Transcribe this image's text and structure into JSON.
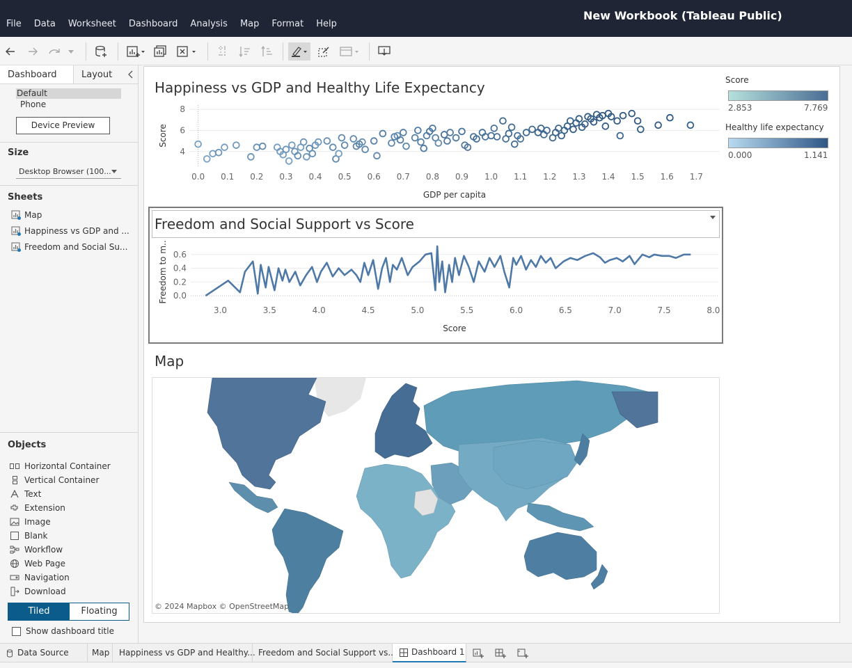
{
  "app": {
    "title": "New Workbook (Tableau Public)",
    "menu": [
      "File",
      "Data",
      "Worksheet",
      "Dashboard",
      "Analysis",
      "Map",
      "Format",
      "Help"
    ]
  },
  "left_panel": {
    "tab_dashboard": "Dashboard",
    "tab_layout": "Layout",
    "device_default": "Default",
    "device_phone": "Phone",
    "device_preview": "Device Preview",
    "size_heading": "Size",
    "size_value": "Desktop Browser (100...",
    "sheets_heading": "Sheets",
    "sheets": [
      "Map",
      "Happiness vs GDP and ...",
      "Freedom and Social Su..."
    ],
    "objects_heading": "Objects",
    "objects": [
      "Horizontal Container",
      "Vertical Container",
      "Text",
      "Extension",
      "Image",
      "Blank",
      "Workflow",
      "Web Page",
      "Navigation",
      "Download"
    ],
    "tiled": "Tiled",
    "floating": "Floating",
    "show_title": "Show dashboard title"
  },
  "dashboard": {
    "chart1_title": "Happiness vs GDP and Healthy Life Expectancy",
    "chart2_title": "Freedom and Social Support vs Score",
    "map_title": "Map",
    "map_attribution": "© 2024 Mapbox  © OpenStreetMap"
  },
  "legends": {
    "score": {
      "title": "Score",
      "min": "2.853",
      "max": "7.769",
      "color_low": "#b6e0dc",
      "color_high": "#4a6e95"
    },
    "life": {
      "title": "Healthy life expectancy",
      "min": "0.000",
      "max": "1.141",
      "color_low": "#b8daf0",
      "color_high": "#2e5786"
    }
  },
  "bottom_tabs": {
    "data_source": "Data Source",
    "tabs": [
      "Map",
      "Happiness vs GDP and Healthy...",
      "Freedom and Social Support vs...",
      "Dashboard 1"
    ]
  },
  "colors": {
    "titlebar": "#1f2535",
    "accent": "#0b5c8a",
    "mark_dark": "#2f5883",
    "mark_light": "#8fb8d8",
    "line": "#4e79a7"
  },
  "chart_data": [
    {
      "type": "scatter",
      "title": "Happiness vs GDP and Healthy Life Expectancy",
      "xlabel": "GDP per capita",
      "ylabel": "Score",
      "xlim": [
        -0.03,
        1.78
      ],
      "ylim": [
        2.6,
        8.4
      ],
      "xticks": [
        "0.0",
        "0.1",
        "0.2",
        "0.3",
        "0.4",
        "0.5",
        "0.6",
        "0.7",
        "0.8",
        "0.9",
        "1.0",
        "1.1",
        "1.2",
        "1.3",
        "1.4",
        "1.5",
        "1.6",
        "1.7"
      ],
      "yticks": [
        "4",
        "6",
        "8"
      ],
      "points": [
        [
          0.0,
          4.7,
          0.3
        ],
        [
          0.03,
          3.3,
          0.25
        ],
        [
          0.05,
          3.8,
          0.3
        ],
        [
          0.07,
          3.9,
          0.4
        ],
        [
          0.09,
          4.4,
          0.3
        ],
        [
          0.13,
          4.6,
          0.35
        ],
        [
          0.18,
          3.5,
          0.4
        ],
        [
          0.2,
          4.4,
          0.45
        ],
        [
          0.22,
          4.5,
          0.5
        ],
        [
          0.27,
          4.4,
          0.3
        ],
        [
          0.28,
          4.0,
          0.35
        ],
        [
          0.29,
          3.7,
          0.3
        ],
        [
          0.3,
          4.2,
          0.4
        ],
        [
          0.31,
          3.1,
          0.25
        ],
        [
          0.32,
          4.6,
          0.35
        ],
        [
          0.33,
          4.0,
          0.4
        ],
        [
          0.34,
          3.6,
          0.45
        ],
        [
          0.35,
          4.4,
          0.3
        ],
        [
          0.36,
          4.9,
          0.4
        ],
        [
          0.37,
          3.5,
          0.35
        ],
        [
          0.38,
          4.3,
          0.5
        ],
        [
          0.39,
          3.8,
          0.45
        ],
        [
          0.4,
          4.6,
          0.4
        ],
        [
          0.41,
          4.9,
          0.35
        ],
        [
          0.44,
          5.0,
          0.45
        ],
        [
          0.46,
          4.4,
          0.5
        ],
        [
          0.47,
          3.3,
          0.55
        ],
        [
          0.48,
          3.8,
          0.3
        ],
        [
          0.49,
          5.3,
          0.5
        ],
        [
          0.5,
          4.6,
          0.55
        ],
        [
          0.53,
          5.2,
          0.5
        ],
        [
          0.54,
          4.5,
          0.55
        ],
        [
          0.55,
          4.7,
          0.6
        ],
        [
          0.56,
          4.9,
          0.45
        ],
        [
          0.57,
          4.2,
          0.55
        ],
        [
          0.6,
          5.0,
          0.6
        ],
        [
          0.61,
          3.6,
          0.5
        ],
        [
          0.63,
          5.7,
          0.65
        ],
        [
          0.66,
          4.8,
          0.55
        ],
        [
          0.67,
          5.4,
          0.6
        ],
        [
          0.68,
          5.5,
          0.45
        ],
        [
          0.69,
          5.1,
          0.65
        ],
        [
          0.7,
          5.8,
          0.6
        ],
        [
          0.71,
          4.5,
          0.55
        ],
        [
          0.74,
          5.3,
          0.6
        ],
        [
          0.75,
          6.0,
          0.65
        ],
        [
          0.76,
          4.9,
          0.6
        ],
        [
          0.77,
          4.3,
          0.7
        ],
        [
          0.78,
          5.5,
          0.65
        ],
        [
          0.79,
          5.9,
          0.7
        ],
        [
          0.8,
          6.2,
          0.7
        ],
        [
          0.81,
          5.3,
          0.6
        ],
        [
          0.82,
          4.8,
          0.5
        ],
        [
          0.84,
          5.6,
          0.75
        ],
        [
          0.85,
          5.0,
          0.7
        ],
        [
          0.86,
          5.8,
          0.65
        ],
        [
          0.88,
          5.3,
          0.7
        ],
        [
          0.9,
          5.9,
          0.75
        ],
        [
          0.91,
          4.6,
          0.7
        ],
        [
          0.92,
          4.4,
          0.7
        ],
        [
          0.94,
          5.4,
          0.75
        ],
        [
          0.95,
          5.2,
          0.8
        ],
        [
          0.97,
          5.8,
          0.75
        ],
        [
          0.98,
          5.4,
          0.75
        ],
        [
          1.0,
          5.5,
          0.8
        ],
        [
          1.01,
          6.2,
          0.75
        ],
        [
          1.02,
          5.4,
          0.8
        ],
        [
          1.04,
          6.9,
          0.85
        ],
        [
          1.05,
          5.2,
          0.8
        ],
        [
          1.06,
          5.7,
          0.85
        ],
        [
          1.07,
          6.3,
          0.8
        ],
        [
          1.08,
          4.7,
          0.85
        ],
        [
          1.09,
          5.5,
          0.8
        ],
        [
          1.1,
          5.2,
          0.75
        ],
        [
          1.12,
          5.8,
          0.85
        ],
        [
          1.14,
          6.1,
          0.85
        ],
        [
          1.16,
          5.8,
          0.9
        ],
        [
          1.17,
          6.2,
          0.9
        ],
        [
          1.18,
          5.6,
          0.85
        ],
        [
          1.19,
          6.0,
          0.85
        ],
        [
          1.21,
          5.3,
          0.9
        ],
        [
          1.22,
          5.8,
          0.9
        ],
        [
          1.23,
          6.2,
          0.9
        ],
        [
          1.24,
          5.5,
          0.95
        ],
        [
          1.25,
          6.0,
          0.9
        ],
        [
          1.26,
          6.4,
          0.95
        ],
        [
          1.27,
          6.9,
          0.95
        ],
        [
          1.28,
          6.1,
          1.0
        ],
        [
          1.29,
          6.7,
          0.95
        ],
        [
          1.3,
          7.1,
          1.0
        ],
        [
          1.31,
          6.3,
          0.95
        ],
        [
          1.32,
          6.6,
          1.0
        ],
        [
          1.33,
          7.3,
          1.0
        ],
        [
          1.34,
          7.1,
          1.0
        ],
        [
          1.35,
          6.8,
          1.05
        ],
        [
          1.36,
          7.5,
          1.0
        ],
        [
          1.37,
          7.2,
          1.05
        ],
        [
          1.38,
          7.4,
          1.05
        ],
        [
          1.39,
          6.4,
          1.0
        ],
        [
          1.4,
          7.6,
          1.05
        ],
        [
          1.41,
          7.3,
          1.05
        ],
        [
          1.43,
          6.9,
          1.05
        ],
        [
          1.44,
          5.5,
          0.9
        ],
        [
          1.45,
          7.4,
          1.05
        ],
        [
          1.48,
          7.6,
          1.05
        ],
        [
          1.5,
          6.9,
          1.05
        ],
        [
          1.51,
          6.1,
          1.0
        ],
        [
          1.57,
          6.5,
          1.0
        ],
        [
          1.61,
          7.2,
          1.05
        ],
        [
          1.68,
          6.5,
          0.95
        ]
      ]
    },
    {
      "type": "line",
      "title": "Freedom and Social Support vs Score",
      "xlabel": "Score",
      "ylabel": "Freedom to m...",
      "xlim": [
        2.7,
        8.05
      ],
      "ylim": [
        -0.05,
        0.78
      ],
      "xticks": [
        "3.0",
        "3.5",
        "4.0",
        "4.5",
        "5.0",
        "5.5",
        "6.0",
        "6.5",
        "7.0",
        "7.5",
        "8.0"
      ],
      "yticks": [
        "0.0",
        "0.2",
        "0.4",
        "0.6"
      ],
      "x": [
        2.85,
        3.08,
        3.2,
        3.25,
        3.33,
        3.38,
        3.41,
        3.46,
        3.49,
        3.55,
        3.59,
        3.63,
        3.66,
        3.7,
        3.76,
        3.81,
        3.87,
        3.93,
        3.98,
        4.02,
        4.08,
        4.14,
        4.2,
        4.26,
        4.33,
        4.38,
        4.42,
        4.46,
        4.5,
        4.55,
        4.6,
        4.64,
        4.68,
        4.72,
        4.75,
        4.79,
        4.84,
        4.9,
        4.95,
        5.02,
        5.08,
        5.14,
        5.18,
        5.2,
        5.22,
        5.25,
        5.28,
        5.32,
        5.35,
        5.38,
        5.42,
        5.47,
        5.52,
        5.57,
        5.62,
        5.68,
        5.73,
        5.78,
        5.84,
        5.88,
        5.93,
        5.97,
        6.0,
        6.05,
        6.1,
        6.15,
        6.2,
        6.25,
        6.3,
        6.35,
        6.4,
        6.48,
        6.55,
        6.62,
        6.7,
        6.78,
        6.85,
        6.9,
        6.95,
        7.02,
        7.08,
        7.15,
        7.2,
        7.28,
        7.35,
        7.4,
        7.48,
        7.55,
        7.62,
        7.7,
        7.77
      ],
      "values": [
        0.0,
        0.22,
        0.05,
        0.35,
        0.5,
        0.03,
        0.45,
        0.12,
        0.42,
        0.08,
        0.4,
        0.22,
        0.38,
        0.2,
        0.35,
        0.15,
        0.3,
        0.42,
        0.2,
        0.35,
        0.48,
        0.28,
        0.4,
        0.3,
        0.38,
        0.3,
        0.2,
        0.48,
        0.3,
        0.52,
        0.1,
        0.4,
        0.55,
        0.2,
        0.45,
        0.38,
        0.55,
        0.3,
        0.42,
        0.5,
        0.6,
        0.62,
        0.08,
        0.72,
        0.2,
        0.5,
        0.05,
        0.45,
        0.2,
        0.55,
        0.3,
        0.58,
        0.42,
        0.2,
        0.5,
        0.35,
        0.55,
        0.42,
        0.58,
        0.35,
        0.12,
        0.55,
        0.45,
        0.58,
        0.38,
        0.52,
        0.42,
        0.58,
        0.48,
        0.55,
        0.4,
        0.5,
        0.55,
        0.52,
        0.58,
        0.62,
        0.56,
        0.48,
        0.52,
        0.55,
        0.5,
        0.58,
        0.46,
        0.6,
        0.56,
        0.6,
        0.58,
        0.58,
        0.55,
        0.6,
        0.6
      ]
    }
  ]
}
